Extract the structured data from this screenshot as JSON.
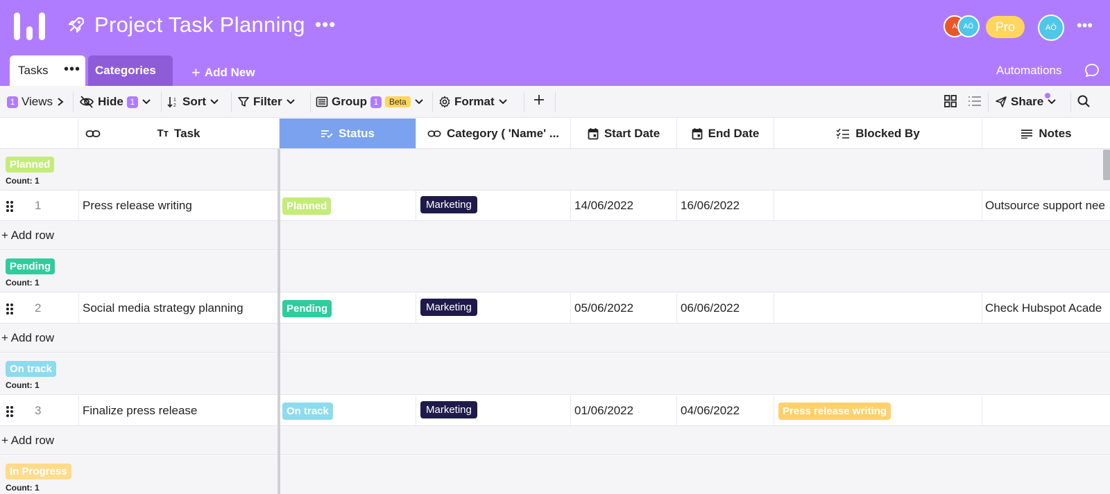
{
  "header": {
    "title": "Project Task Planning",
    "title_menu_icon": "more-horizontal-icon",
    "collaborators": [
      {
        "initials": "A",
        "color": "#e8562a"
      },
      {
        "initials": "AÖ",
        "color": "#4ec7e8"
      }
    ],
    "plan_badge": "Pro",
    "user_initials": "AÖ"
  },
  "tabs": [
    {
      "label": "Tasks",
      "active": true
    },
    {
      "label": "Categories",
      "active": false
    }
  ],
  "add_new_label": "Add New",
  "automations_label": "Automations",
  "toolbar": {
    "views_count": "1",
    "views_label": "Views",
    "hide_count": "1",
    "hide_label": "Hide",
    "sort_label": "Sort",
    "filter_label": "Filter",
    "group_count": "1",
    "group_label": "Group",
    "beta_label": "Beta",
    "format_label": "Format",
    "share_label": "Share"
  },
  "columns": [
    {
      "key": "task",
      "label": "Task",
      "icon": "text-type-icon"
    },
    {
      "key": "status",
      "label": "Status",
      "icon": "single-select-icon",
      "active": true
    },
    {
      "key": "category",
      "label": "Category ( 'Name' ...",
      "icon": "link-icon"
    },
    {
      "key": "start_date",
      "label": "Start Date",
      "icon": "calendar-icon"
    },
    {
      "key": "end_date",
      "label": "End Date",
      "icon": "calendar-icon"
    },
    {
      "key": "blocked_by",
      "label": "Blocked By",
      "icon": "checklist-icon"
    },
    {
      "key": "notes",
      "label": "Notes",
      "icon": "long-text-icon"
    }
  ],
  "groups": [
    {
      "status": "Planned",
      "color": "#c4ec79",
      "count_label": "Count: 1",
      "rows": [
        {
          "num": "1",
          "task": "Press release writing",
          "category": "Marketing",
          "start_date": "14/06/2022",
          "end_date": "16/06/2022",
          "blocked_by": "",
          "notes": "Outsource support nee"
        }
      ]
    },
    {
      "status": "Pending",
      "color": "#2fcc9d",
      "count_label": "Count: 1",
      "rows": [
        {
          "num": "2",
          "task": "Social media strategy planning",
          "category": "Marketing",
          "start_date": "05/06/2022",
          "end_date": "06/06/2022",
          "blocked_by": "",
          "notes": "Check Hubspot Acade"
        }
      ]
    },
    {
      "status": "On track",
      "color": "#8ddbee",
      "count_label": "Count: 1",
      "rows": [
        {
          "num": "3",
          "task": "Finalize press release",
          "category": "Marketing",
          "start_date": "01/06/2022",
          "end_date": "04/06/2022",
          "blocked_by": "Press release writing",
          "blocked_by_color": "#ffd06b",
          "notes": ""
        }
      ]
    },
    {
      "status": "In Progress",
      "color": "#ffdb8a",
      "count_label": "Count: 1",
      "rows": []
    }
  ],
  "add_row_label": "+ Add row"
}
